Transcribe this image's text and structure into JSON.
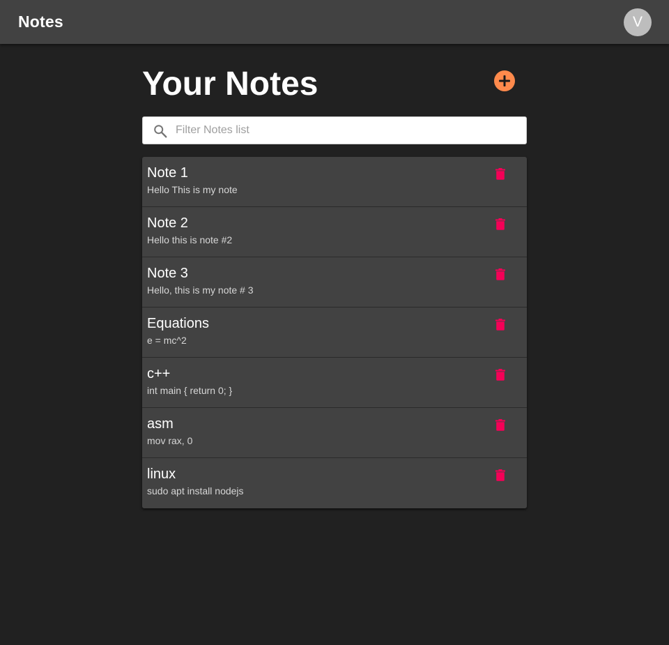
{
  "appbar": {
    "title": "Notes",
    "avatar_letter": "V"
  },
  "main": {
    "page_title": "Your Notes",
    "add_icon": "plus-circle-icon",
    "search": {
      "placeholder": "Filter Notes list",
      "value": "",
      "icon": "search-icon"
    },
    "notes": [
      {
        "title": "Note 1",
        "body": "Hello This is my note"
      },
      {
        "title": "Note 2",
        "body": "Hello this is note #2"
      },
      {
        "title": "Note 3",
        "body": "Hello, this is my note # 3"
      },
      {
        "title": "Equations",
        "body": "e = mc^2"
      },
      {
        "title": "c++",
        "body": "int main { return 0; }"
      },
      {
        "title": "asm",
        "body": "mov rax, 0"
      },
      {
        "title": "linux",
        "body": "sudo apt install nodejs"
      }
    ]
  },
  "colors": {
    "background": "#212121",
    "appbar": "#424242",
    "accent": "#ff8a4c",
    "delete": "#f50057",
    "avatar": "#bdbdbd"
  }
}
